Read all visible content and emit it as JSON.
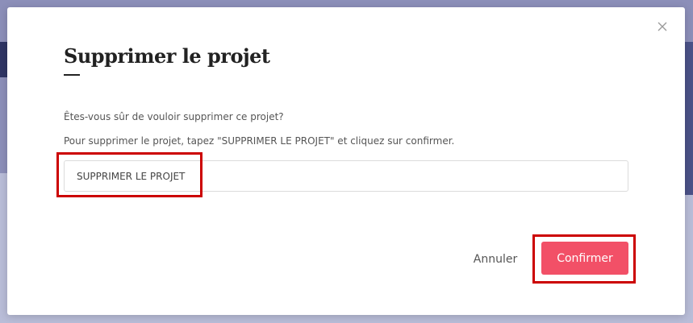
{
  "modal": {
    "title": "Supprimer le projet",
    "question": "Êtes-vous sûr de vouloir supprimer ce projet?",
    "instruction": "Pour supprimer le projet, tapez \"SUPPRIMER LE PROJET\" et cliquez sur confirmer.",
    "input_value": "SUPPRIMER LE PROJET",
    "cancel_label": "Annuler",
    "confirm_label": "Confirmer",
    "close_icon": "close-icon"
  },
  "colors": {
    "accent": "#f25067",
    "highlight": "#cc0000",
    "backdrop": "#8c8fb9"
  }
}
